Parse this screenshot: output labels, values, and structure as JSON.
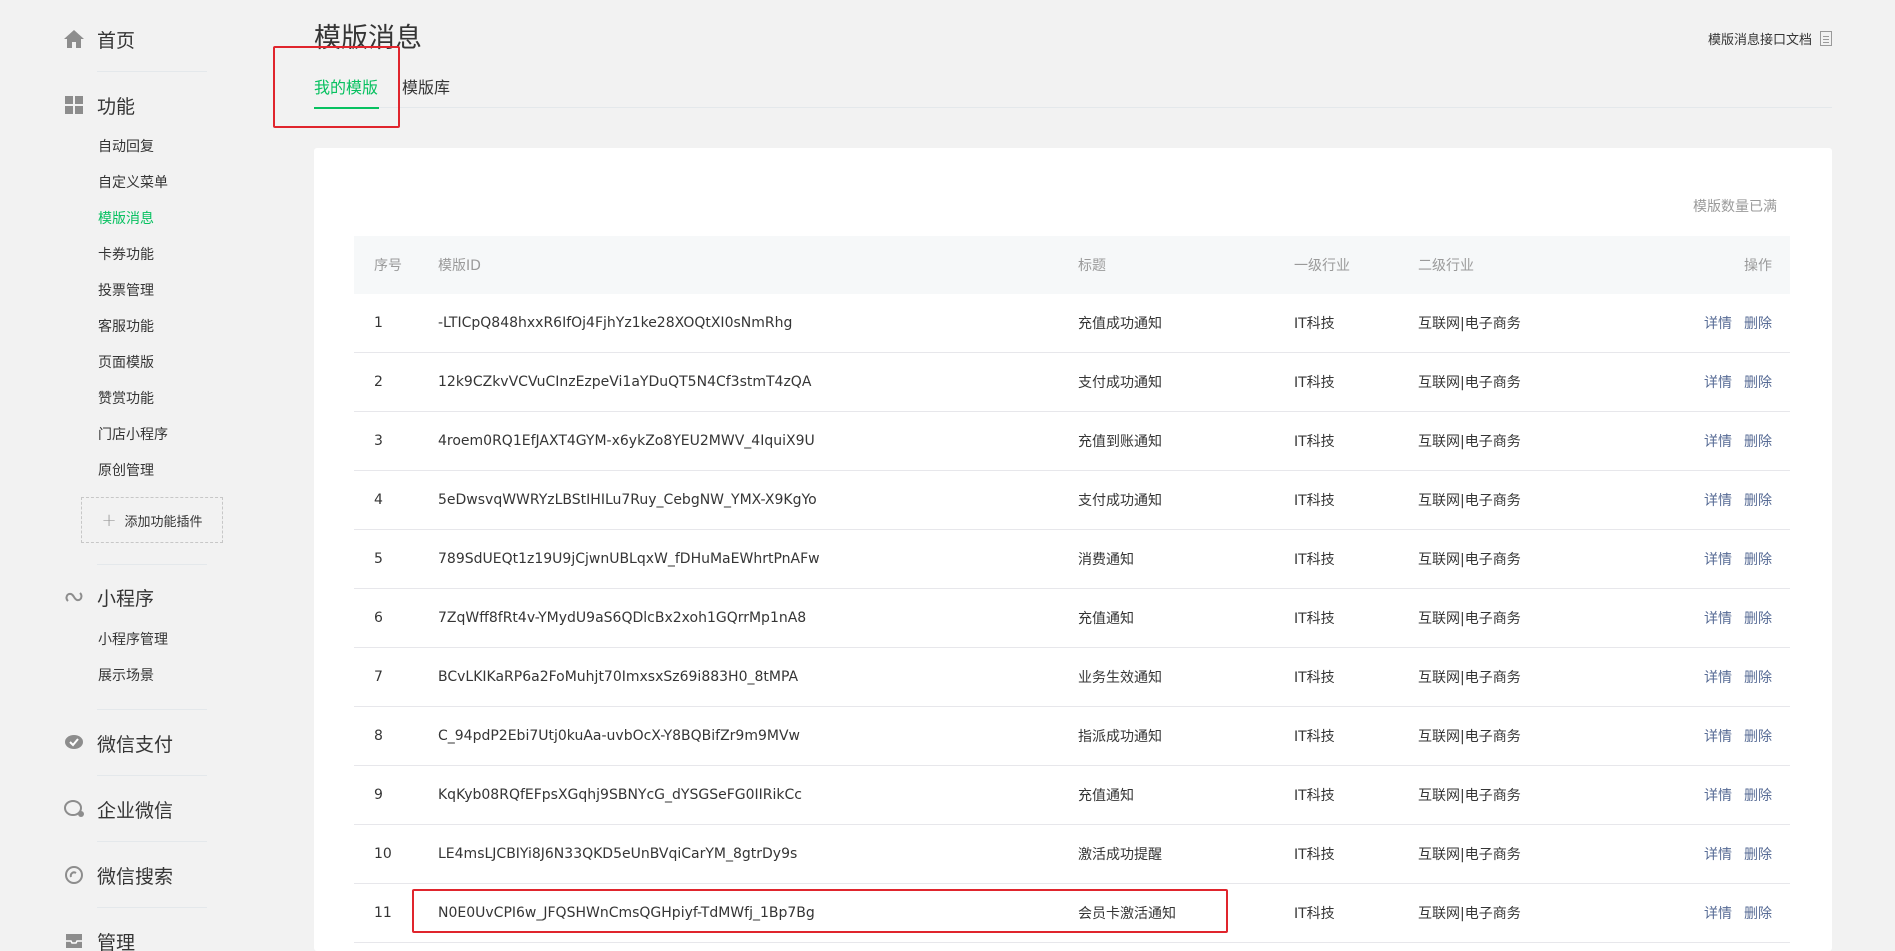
{
  "sidebar": {
    "home": "首页",
    "features": {
      "label": "功能",
      "items": [
        "自动回复",
        "自定义菜单",
        "模版消息",
        "卡券功能",
        "投票管理",
        "客服功能",
        "页面模版",
        "赞赏功能",
        "门店小程序",
        "原创管理"
      ],
      "active_index": 2,
      "add_plugin": "添加功能插件"
    },
    "mini_program": {
      "label": "小程序",
      "items": [
        "小程序管理",
        "展示场景"
      ]
    },
    "wechat_pay": "微信支付",
    "work_wechat": "企业微信",
    "wechat_search": "微信搜索",
    "manage": "管理"
  },
  "header": {
    "title": "模版消息",
    "doc_link": "模版消息接口文档"
  },
  "tabs": {
    "mine": "我的模版",
    "library": "模版库"
  },
  "panel": {
    "quota": "模版数量已满"
  },
  "table": {
    "headers": {
      "idx": "序号",
      "id": "模版ID",
      "title": "标题",
      "ind1": "一级行业",
      "ind2": "二级行业",
      "ops": "操作"
    },
    "rows": [
      {
        "idx": "1",
        "id": "-LTICpQ848hxxR6IfOj4FjhYz1ke28XOQtXI0sNmRhg",
        "title": "充值成功通知",
        "ind1": "IT科技",
        "ind2": "互联网|电子商务",
        "detail": "详情",
        "delete": "删除"
      },
      {
        "idx": "2",
        "id": "12k9CZkvVCVuCInzEzpeVi1aYDuQT5N4Cf3stmT4zQA",
        "title": "支付成功通知",
        "ind1": "IT科技",
        "ind2": "互联网|电子商务",
        "detail": "详情",
        "delete": "删除"
      },
      {
        "idx": "3",
        "id": "4roem0RQ1EfJAXT4GYM-x6ykZo8YEU2MWV_4IquiX9U",
        "title": "充值到账通知",
        "ind1": "IT科技",
        "ind2": "互联网|电子商务",
        "detail": "详情",
        "delete": "删除"
      },
      {
        "idx": "4",
        "id": "5eDwsvqWWRYzLBStIHILu7Ruy_CebgNW_YMX-X9KgYo",
        "title": "支付成功通知",
        "ind1": "IT科技",
        "ind2": "互联网|电子商务",
        "detail": "详情",
        "delete": "删除"
      },
      {
        "idx": "5",
        "id": "789SdUEQt1z19U9jCjwnUBLqxW_fDHuMaEWhrtPnAFw",
        "title": "消费通知",
        "ind1": "IT科技",
        "ind2": "互联网|电子商务",
        "detail": "详情",
        "delete": "删除"
      },
      {
        "idx": "6",
        "id": "7ZqWff8fRt4v-YMydU9aS6QDlcBx2xoh1GQrrMp1nA8",
        "title": "充值通知",
        "ind1": "IT科技",
        "ind2": "互联网|电子商务",
        "detail": "详情",
        "delete": "删除"
      },
      {
        "idx": "7",
        "id": "BCvLKIKaRP6a2FoMuhjt70ImxsxSz69i883H0_8tMPA",
        "title": "业务生效通知",
        "ind1": "IT科技",
        "ind2": "互联网|电子商务",
        "detail": "详情",
        "delete": "删除"
      },
      {
        "idx": "8",
        "id": "C_94pdP2Ebi7Utj0kuAa-uvbOcX-Y8BQBifZr9m9MVw",
        "title": "指派成功通知",
        "ind1": "IT科技",
        "ind2": "互联网|电子商务",
        "detail": "详情",
        "delete": "删除"
      },
      {
        "idx": "9",
        "id": "KqKyb08RQfEFpsXGqhj9SBNYcG_dYSGSeFG0IIRikCc",
        "title": "充值通知",
        "ind1": "IT科技",
        "ind2": "互联网|电子商务",
        "detail": "详情",
        "delete": "删除"
      },
      {
        "idx": "10",
        "id": "LE4msLJCBIYi8J6N33QKD5eUnBVqiCarYM_8gtrDy9s",
        "title": "激活成功提醒",
        "ind1": "IT科技",
        "ind2": "互联网|电子商务",
        "detail": "详情",
        "delete": "删除"
      },
      {
        "idx": "11",
        "id": "N0E0UvCPI6w_JFQSHWnCmsQGHpiyf-TdMWfj_1Bp7Bg",
        "title": "会员卡激活通知",
        "ind1": "IT科技",
        "ind2": "互联网|电子商务",
        "detail": "详情",
        "delete": "删除"
      }
    ]
  },
  "colors": {
    "accent": "#07c160",
    "link": "#576b95",
    "annotation": "#e0252d"
  }
}
